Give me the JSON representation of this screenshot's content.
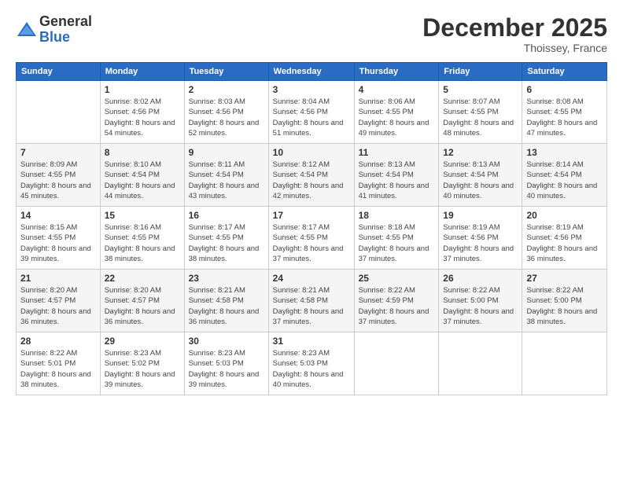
{
  "logo": {
    "general": "General",
    "blue": "Blue"
  },
  "header": {
    "month": "December 2025",
    "location": "Thoissey, France"
  },
  "weekdays": [
    "Sunday",
    "Monday",
    "Tuesday",
    "Wednesday",
    "Thursday",
    "Friday",
    "Saturday"
  ],
  "weeks": [
    [
      {
        "day": "",
        "sunrise": "",
        "sunset": "",
        "daylight": ""
      },
      {
        "day": "1",
        "sunrise": "Sunrise: 8:02 AM",
        "sunset": "Sunset: 4:56 PM",
        "daylight": "Daylight: 8 hours and 54 minutes."
      },
      {
        "day": "2",
        "sunrise": "Sunrise: 8:03 AM",
        "sunset": "Sunset: 4:56 PM",
        "daylight": "Daylight: 8 hours and 52 minutes."
      },
      {
        "day": "3",
        "sunrise": "Sunrise: 8:04 AM",
        "sunset": "Sunset: 4:56 PM",
        "daylight": "Daylight: 8 hours and 51 minutes."
      },
      {
        "day": "4",
        "sunrise": "Sunrise: 8:06 AM",
        "sunset": "Sunset: 4:55 PM",
        "daylight": "Daylight: 8 hours and 49 minutes."
      },
      {
        "day": "5",
        "sunrise": "Sunrise: 8:07 AM",
        "sunset": "Sunset: 4:55 PM",
        "daylight": "Daylight: 8 hours and 48 minutes."
      },
      {
        "day": "6",
        "sunrise": "Sunrise: 8:08 AM",
        "sunset": "Sunset: 4:55 PM",
        "daylight": "Daylight: 8 hours and 47 minutes."
      }
    ],
    [
      {
        "day": "7",
        "sunrise": "Sunrise: 8:09 AM",
        "sunset": "Sunset: 4:55 PM",
        "daylight": "Daylight: 8 hours and 45 minutes."
      },
      {
        "day": "8",
        "sunrise": "Sunrise: 8:10 AM",
        "sunset": "Sunset: 4:54 PM",
        "daylight": "Daylight: 8 hours and 44 minutes."
      },
      {
        "day": "9",
        "sunrise": "Sunrise: 8:11 AM",
        "sunset": "Sunset: 4:54 PM",
        "daylight": "Daylight: 8 hours and 43 minutes."
      },
      {
        "day": "10",
        "sunrise": "Sunrise: 8:12 AM",
        "sunset": "Sunset: 4:54 PM",
        "daylight": "Daylight: 8 hours and 42 minutes."
      },
      {
        "day": "11",
        "sunrise": "Sunrise: 8:13 AM",
        "sunset": "Sunset: 4:54 PM",
        "daylight": "Daylight: 8 hours and 41 minutes."
      },
      {
        "day": "12",
        "sunrise": "Sunrise: 8:13 AM",
        "sunset": "Sunset: 4:54 PM",
        "daylight": "Daylight: 8 hours and 40 minutes."
      },
      {
        "day": "13",
        "sunrise": "Sunrise: 8:14 AM",
        "sunset": "Sunset: 4:54 PM",
        "daylight": "Daylight: 8 hours and 40 minutes."
      }
    ],
    [
      {
        "day": "14",
        "sunrise": "Sunrise: 8:15 AM",
        "sunset": "Sunset: 4:55 PM",
        "daylight": "Daylight: 8 hours and 39 minutes."
      },
      {
        "day": "15",
        "sunrise": "Sunrise: 8:16 AM",
        "sunset": "Sunset: 4:55 PM",
        "daylight": "Daylight: 8 hours and 38 minutes."
      },
      {
        "day": "16",
        "sunrise": "Sunrise: 8:17 AM",
        "sunset": "Sunset: 4:55 PM",
        "daylight": "Daylight: 8 hours and 38 minutes."
      },
      {
        "day": "17",
        "sunrise": "Sunrise: 8:17 AM",
        "sunset": "Sunset: 4:55 PM",
        "daylight": "Daylight: 8 hours and 37 minutes."
      },
      {
        "day": "18",
        "sunrise": "Sunrise: 8:18 AM",
        "sunset": "Sunset: 4:55 PM",
        "daylight": "Daylight: 8 hours and 37 minutes."
      },
      {
        "day": "19",
        "sunrise": "Sunrise: 8:19 AM",
        "sunset": "Sunset: 4:56 PM",
        "daylight": "Daylight: 8 hours and 37 minutes."
      },
      {
        "day": "20",
        "sunrise": "Sunrise: 8:19 AM",
        "sunset": "Sunset: 4:56 PM",
        "daylight": "Daylight: 8 hours and 36 minutes."
      }
    ],
    [
      {
        "day": "21",
        "sunrise": "Sunrise: 8:20 AM",
        "sunset": "Sunset: 4:57 PM",
        "daylight": "Daylight: 8 hours and 36 minutes."
      },
      {
        "day": "22",
        "sunrise": "Sunrise: 8:20 AM",
        "sunset": "Sunset: 4:57 PM",
        "daylight": "Daylight: 8 hours and 36 minutes."
      },
      {
        "day": "23",
        "sunrise": "Sunrise: 8:21 AM",
        "sunset": "Sunset: 4:58 PM",
        "daylight": "Daylight: 8 hours and 36 minutes."
      },
      {
        "day": "24",
        "sunrise": "Sunrise: 8:21 AM",
        "sunset": "Sunset: 4:58 PM",
        "daylight": "Daylight: 8 hours and 37 minutes."
      },
      {
        "day": "25",
        "sunrise": "Sunrise: 8:22 AM",
        "sunset": "Sunset: 4:59 PM",
        "daylight": "Daylight: 8 hours and 37 minutes."
      },
      {
        "day": "26",
        "sunrise": "Sunrise: 8:22 AM",
        "sunset": "Sunset: 5:00 PM",
        "daylight": "Daylight: 8 hours and 37 minutes."
      },
      {
        "day": "27",
        "sunrise": "Sunrise: 8:22 AM",
        "sunset": "Sunset: 5:00 PM",
        "daylight": "Daylight: 8 hours and 38 minutes."
      }
    ],
    [
      {
        "day": "28",
        "sunrise": "Sunrise: 8:22 AM",
        "sunset": "Sunset: 5:01 PM",
        "daylight": "Daylight: 8 hours and 38 minutes."
      },
      {
        "day": "29",
        "sunrise": "Sunrise: 8:23 AM",
        "sunset": "Sunset: 5:02 PM",
        "daylight": "Daylight: 8 hours and 39 minutes."
      },
      {
        "day": "30",
        "sunrise": "Sunrise: 8:23 AM",
        "sunset": "Sunset: 5:03 PM",
        "daylight": "Daylight: 8 hours and 39 minutes."
      },
      {
        "day": "31",
        "sunrise": "Sunrise: 8:23 AM",
        "sunset": "Sunset: 5:03 PM",
        "daylight": "Daylight: 8 hours and 40 minutes."
      },
      {
        "day": "",
        "sunrise": "",
        "sunset": "",
        "daylight": ""
      },
      {
        "day": "",
        "sunrise": "",
        "sunset": "",
        "daylight": ""
      },
      {
        "day": "",
        "sunrise": "",
        "sunset": "",
        "daylight": ""
      }
    ]
  ]
}
